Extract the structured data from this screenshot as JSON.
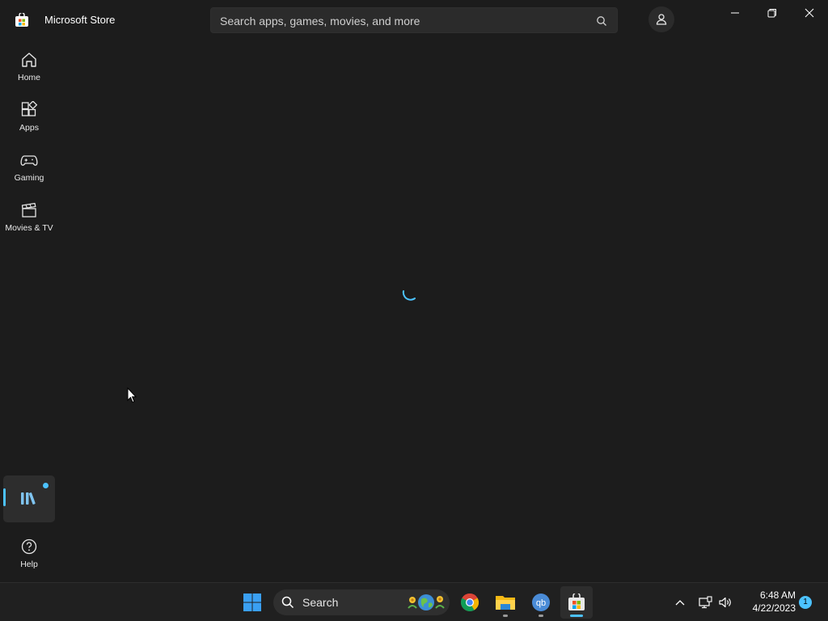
{
  "app": {
    "title": "Microsoft Store"
  },
  "search": {
    "placeholder": "Search apps, games, movies, and more"
  },
  "nav": {
    "items": [
      {
        "label": "Home",
        "icon": "home-icon"
      },
      {
        "label": "Apps",
        "icon": "apps-icon"
      },
      {
        "label": "Gaming",
        "icon": "gamepad-icon"
      },
      {
        "label": "Movies & TV",
        "icon": "clapperboard-icon"
      }
    ],
    "library_icon": "library-icon",
    "help_label": "Help"
  },
  "taskbar": {
    "search_label": "Search",
    "apps": [
      "start-icon",
      "chrome-icon",
      "file-explorer-icon",
      "qbittorrent-icon",
      "microsoft-store-icon"
    ],
    "clock_time": "6:48 AM",
    "clock_date": "4/22/2023",
    "notification_count": "1"
  },
  "colors": {
    "background": "#1c1c1c",
    "accent": "#4cc2ff",
    "taskbar": "#202020"
  }
}
